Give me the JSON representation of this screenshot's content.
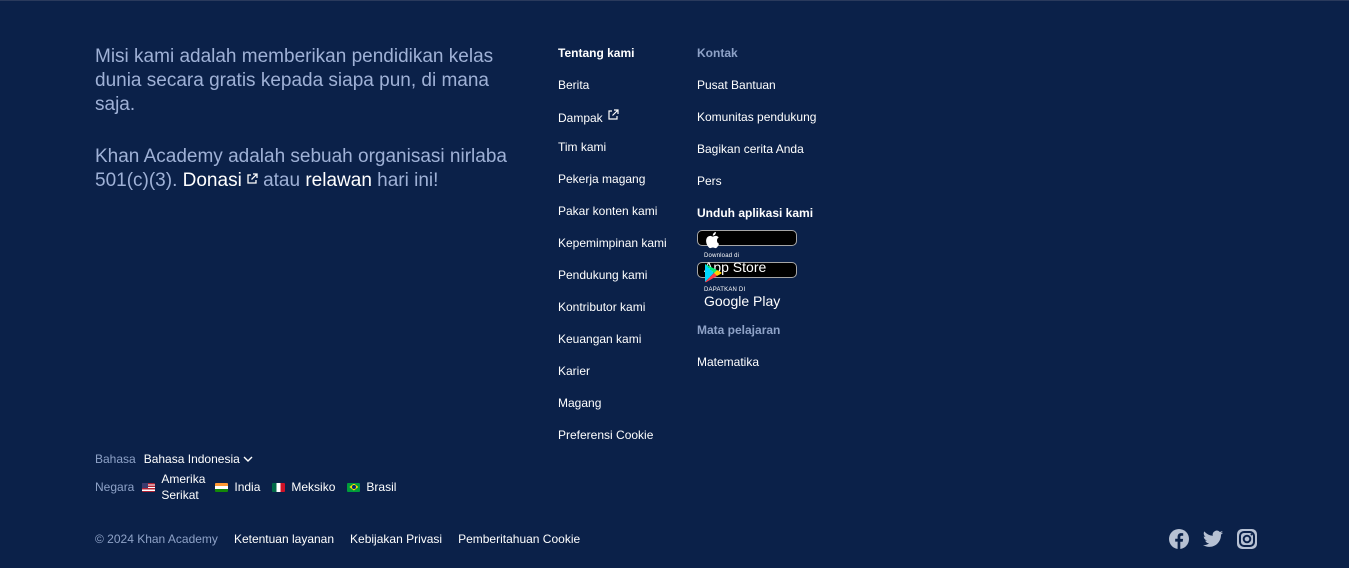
{
  "mission": {
    "line1": "Misi kami adalah memberikan pendidikan kelas dunia secara gratis kepada siapa pun, di mana saja.",
    "line2_prefix": "Khan Academy adalah sebuah organisasi nirlaba 501(c)(3).",
    "donate": "Donasi",
    "or": "atau",
    "volunteer": "relawan",
    "suffix": "hari ini!"
  },
  "about": {
    "heading": "Tentang kami",
    "links": [
      "Berita",
      "Dampak",
      "Tim kami",
      "Pekerja magang",
      "Pakar konten kami",
      "Kepemimpinan kami",
      "Pendukung kami",
      "Kontributor kami",
      "Keuangan kami",
      "Karier",
      "Magang",
      "Preferensi Cookie"
    ]
  },
  "contact": {
    "heading": "Kontak",
    "links": [
      "Pusat Bantuan",
      "Komunitas pendukung",
      "Bagikan cerita Anda",
      "Pers"
    ],
    "apps_heading": "Unduh aplikasi kami",
    "appstore_small": "Download di",
    "appstore_big": "App Store",
    "googleplay_small": "DAPATKAN DI",
    "googleplay_big": "Google Play",
    "subjects_heading": "Mata pelajaran",
    "subjects": [
      "Matematika"
    ]
  },
  "language": {
    "label": "Bahasa",
    "value": "Bahasa Indonesia",
    "country_label": "Negara",
    "countries": [
      "Amerika Serikat",
      "India",
      "Meksiko",
      "Brasil"
    ]
  },
  "footer": {
    "copyright": "© 2024 Khan Academy",
    "links": [
      "Ketentuan layanan",
      "Kebijakan Privasi",
      "Pemberitahuan Cookie"
    ]
  },
  "colors": {
    "background": "#0b2149",
    "muted": "#8ea2c7",
    "mission_text": "#9fb1d6"
  },
  "social_icons": [
    "facebook-icon",
    "twitter-icon",
    "instagram-icon"
  ]
}
